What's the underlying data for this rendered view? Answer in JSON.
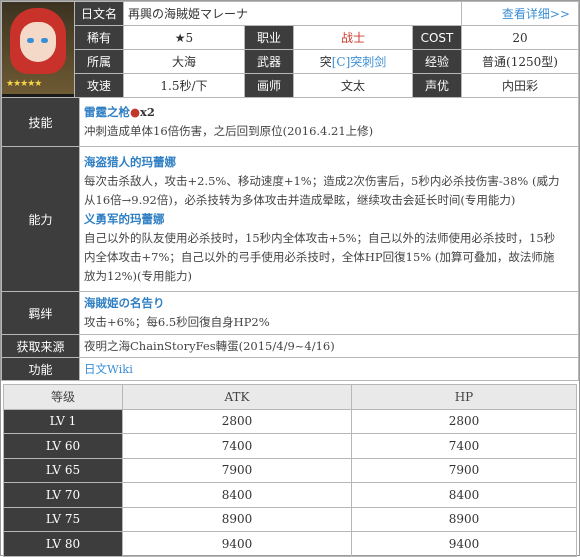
{
  "header": {
    "jp_name_label": "日文名",
    "jp_name": "再興の海賊姫マレーナ",
    "details_link": "查看详细>>"
  },
  "info": {
    "rarity_label": "稀有",
    "rarity": "★5",
    "job_label": "职业",
    "job": "战士",
    "cost_label": "COST",
    "cost": "20",
    "faction_label": "所属",
    "faction": "大海",
    "weapon_label": "武器",
    "weapon_prefix": "突",
    "weapon_bracket": "[C]",
    "weapon": "突刺剑",
    "exp_label": "经验",
    "exp": "普通(1250型)",
    "speed_label": "攻速",
    "speed": "1.5秒/下",
    "artist_label": "画师",
    "artist": "文太",
    "voice_label": "声优",
    "voice": "内田彩"
  },
  "skill": {
    "label": "技能",
    "name": "雷霆之枪",
    "mult": "x2",
    "desc": "冲刺造成单体16倍伤害，之后回到原位(2016.4.21上修)"
  },
  "ability": {
    "label": "能力",
    "a1_name": "海盗猎人的玛蕾娜",
    "a1_line1": "每次击杀敌人，攻击+2.5%、移动速度+1%；造成2次伤害后，5秒内必杀技伤害-38% (威力",
    "a1_line2": "从16倍→9.92倍)，必杀技转为多体攻击并造成晕眩，继续攻击会延长时间(专用能力)",
    "a2_name": "义勇军的玛蕾娜",
    "a2_line1": "自己以外的队友使用必杀技时，15秒内全体攻击+5%；自己以外的法师使用必杀技时，15秒",
    "a2_line2": "内全体攻击+7%；自己以外的弓手使用必杀技时，全体HP回復15% (加算可叠加，故法师施",
    "a2_line3": "放为12%)(专用能力)"
  },
  "bond": {
    "label": "羁绊",
    "name": "海賊姫の名告り",
    "desc": "攻击+6%；每6.5秒回復自身HP2%"
  },
  "source": {
    "label": "获取来源",
    "value": "夜明之海ChainStoryFes轉蛋(2015/4/9~4/16)"
  },
  "function": {
    "label": "功能",
    "value": "日文Wiki"
  },
  "stats": {
    "col_level": "等级",
    "col_atk": "ATK",
    "col_hp": "HP",
    "rows": [
      {
        "lv": "LV 1",
        "atk": "2800",
        "hp": "2800"
      },
      {
        "lv": "LV 60",
        "atk": "7400",
        "hp": "7400"
      },
      {
        "lv": "LV 65",
        "atk": "7900",
        "hp": "7900"
      },
      {
        "lv": "LV 70",
        "atk": "8400",
        "hp": "8400"
      },
      {
        "lv": "LV 75",
        "atk": "8900",
        "hp": "8900"
      },
      {
        "lv": "LV 80",
        "atk": "9400",
        "hp": "9400"
      }
    ]
  }
}
